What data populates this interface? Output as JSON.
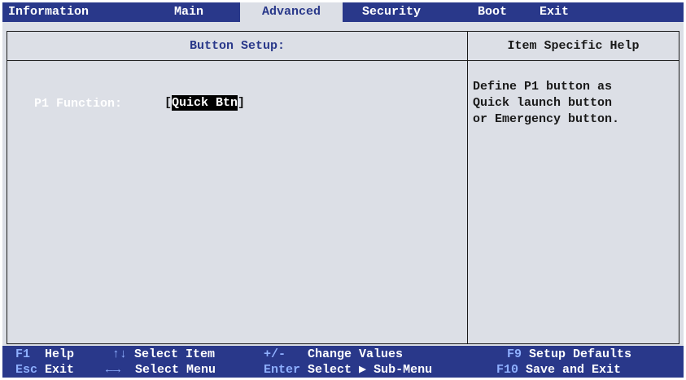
{
  "menu": {
    "items": [
      {
        "label": "Information"
      },
      {
        "label": "Main"
      },
      {
        "label": "Advanced"
      },
      {
        "label": "Security"
      },
      {
        "label": "Boot"
      },
      {
        "label": "Exit"
      }
    ],
    "active": "Advanced"
  },
  "left_panel": {
    "title": "Button Setup:",
    "setting": {
      "label": "P1 Function:",
      "open_bracket": "[",
      "value": "Quick Btn",
      "close_bracket": "]"
    }
  },
  "right_panel": {
    "title": "Item Specific Help",
    "help_lines": [
      "Define P1 button as",
      "Quick launch button",
      "or Emergency button."
    ]
  },
  "keys": {
    "row1": [
      {
        "key": "F1",
        "desc": "Help"
      },
      {
        "key": "↑↓",
        "desc": "Select Item"
      },
      {
        "key": "+/-",
        "desc": "Change Values"
      },
      {
        "key": "F9",
        "desc": "Setup Defaults"
      }
    ],
    "row2": [
      {
        "key": "Esc",
        "desc": "Exit"
      },
      {
        "key": "←→",
        "desc": "Select Menu"
      },
      {
        "key": "Enter",
        "desc": "Select ▶ Sub-Menu"
      },
      {
        "key": "F10",
        "desc": "Save and Exit"
      }
    ]
  },
  "colors": {
    "bar_blue": "#29388a",
    "panel_gray": "#dcdfe6",
    "key_highlight": "#8fb0ff"
  }
}
